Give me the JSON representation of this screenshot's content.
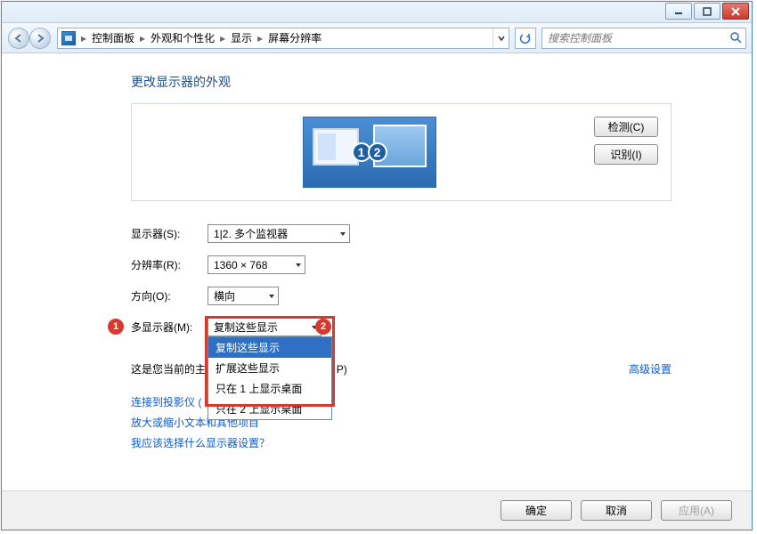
{
  "titlebar": {},
  "breadcrumb": {
    "item1": "控制面板",
    "item2": "外观和个性化",
    "item3": "显示",
    "item4": "屏幕分辨率"
  },
  "search": {
    "placeholder": "搜索控制面板"
  },
  "page_title": "更改显示器的外观",
  "preview": {
    "badge1": "1",
    "badge2": "2",
    "detect_label": "检测(C)",
    "identify_label": "识别(I)"
  },
  "form": {
    "display_label": "显示器(S):",
    "display_value": "1|2. 多个监视器",
    "resolution_label": "分辨率(R):",
    "resolution_value": "1360 × 768",
    "orientation_label": "方向(O):",
    "orientation_value": "横向",
    "multi_label": "多显示器(M):",
    "multi_value": "复制这些显示",
    "multi_options": {
      "o0": "复制这些显示",
      "o1": "扩展这些显示",
      "o2": "只在 1 上显示桌面",
      "o3": "只在 2 上显示桌面"
    }
  },
  "main_display_text_prefix": "这是您当前的主",
  "main_display_text_suffix_visible": "P)",
  "advanced_link": "高级设置",
  "links": {
    "projector": "连接到投影仪 (",
    "text_size": "放大或缩小文本和其他项目",
    "which_display": "我应该选择什么显示器设置？"
  },
  "footer": {
    "ok": "确定",
    "cancel": "取消",
    "apply": "应用(A)"
  },
  "annotations": {
    "marker1": "1",
    "marker2": "2"
  }
}
